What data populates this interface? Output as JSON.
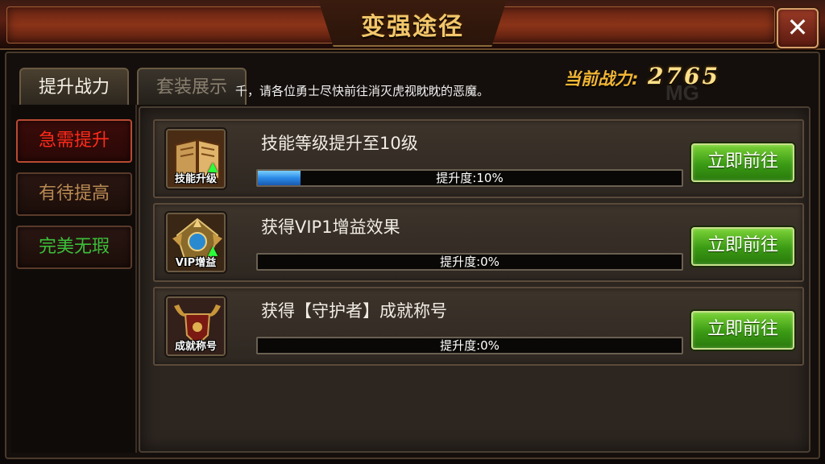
{
  "window": {
    "title": "变强途径",
    "close_icon": "close-x-icon"
  },
  "tabs": [
    {
      "label": "提升战力",
      "active": true
    },
    {
      "label": "套装展示",
      "active": false
    }
  ],
  "notice": "千，请各位勇士尽快前往消灭虎视眈眈的恶魔。",
  "power": {
    "label": "当前战力:",
    "value": "2765"
  },
  "categories": [
    {
      "label": "急需提升",
      "active": true
    },
    {
      "label": "有待提高",
      "active": false
    },
    {
      "label": "完美无瑕",
      "active": false
    }
  ],
  "tasks": [
    {
      "icon": "skill-book-icon",
      "icon_caption": "技能升级",
      "title": "技能等级提升至10级",
      "progress_text": "提升度:10%",
      "progress": 0.1,
      "button": "立即前往"
    },
    {
      "icon": "vip-emblem-icon",
      "icon_caption": "VIP增益",
      "title": "获得VIP1增益效果",
      "progress_text": "提升度:0%",
      "progress": 0.0,
      "button": "立即前往"
    },
    {
      "icon": "guardian-shield-icon",
      "icon_caption": "成就称号",
      "title": "获得【守护者】成就称号",
      "progress_text": "提升度:0%",
      "progress": 0.0,
      "button": "立即前往"
    }
  ],
  "colors": {
    "title_gold": "#f2c66a",
    "category_active_red": "#ff2a1a",
    "category_medium": "#b88a52",
    "category_perfect_green": "#3cc13a",
    "button_green": "#3a9a14",
    "progress_blue": "#2a8ae6"
  }
}
